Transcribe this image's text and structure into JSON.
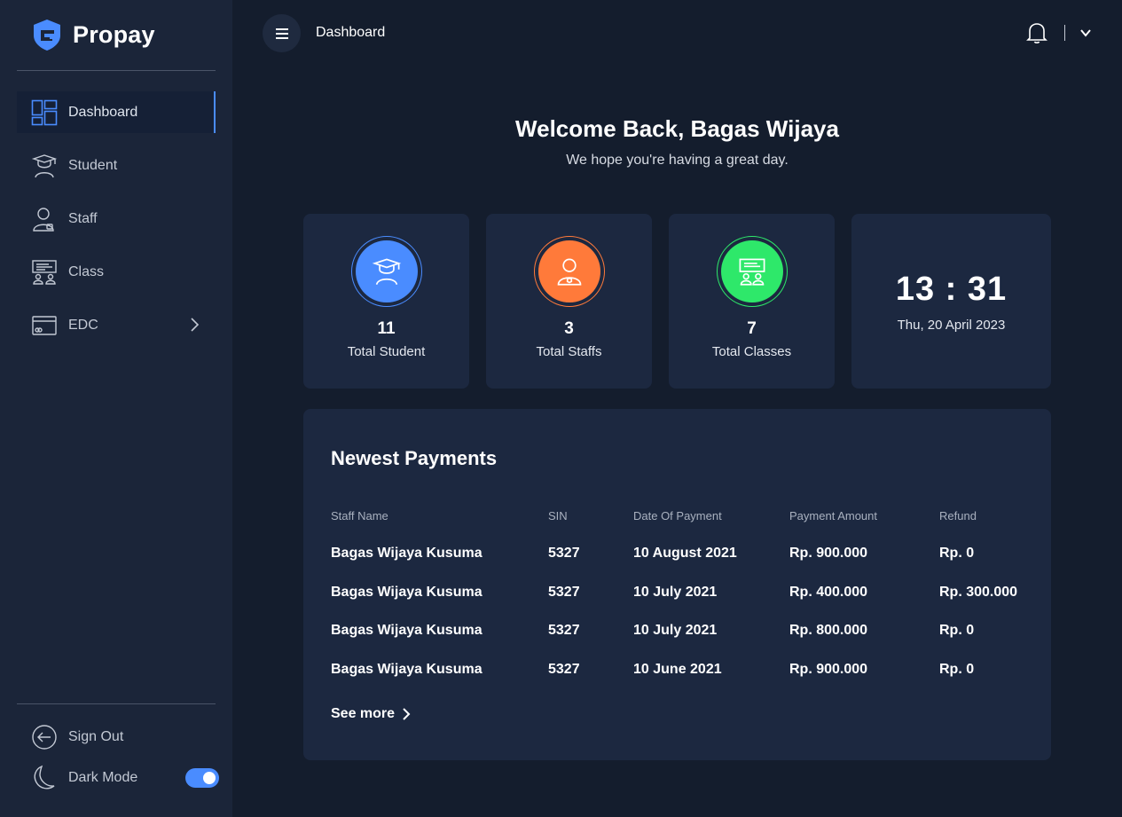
{
  "brand": {
    "name": "Propay",
    "accent": "#4a8cff"
  },
  "sidebar": {
    "items": [
      {
        "label": "Dashboard",
        "icon": "dashboard-icon",
        "active": true
      },
      {
        "label": "Student",
        "icon": "graduation-cap-icon"
      },
      {
        "label": "Staff",
        "icon": "staff-icon"
      },
      {
        "label": "Class",
        "icon": "classroom-icon"
      },
      {
        "label": "EDC",
        "icon": "card-terminal-icon",
        "has_submenu": true
      }
    ],
    "bottom": {
      "sign_out": "Sign Out",
      "dark_mode": "Dark Mode",
      "dark_mode_on": true
    }
  },
  "topbar": {
    "breadcrumb": "Dashboard",
    "icons": [
      "menu-icon",
      "bell-icon",
      "chevron-down-icon"
    ]
  },
  "welcome": {
    "title": "Welcome Back, Bagas Wijaya",
    "subtitle": "We hope you're having a great day."
  },
  "stats": [
    {
      "value": "11",
      "label": "Total Student",
      "color": "#4a8cff",
      "icon": "graduation-cap-icon"
    },
    {
      "value": "3",
      "label": "Total Staffs",
      "color": "#ff7a3a",
      "icon": "staff-icon"
    },
    {
      "value": "7",
      "label": "Total Classes",
      "color": "#2ee86a",
      "icon": "classroom-icon"
    }
  ],
  "clock": {
    "time": "13 : 31",
    "date": "Thu, 20 April 2023"
  },
  "payments": {
    "title": "Newest Payments",
    "columns": [
      "Staff Name",
      "SIN",
      "Date Of Payment",
      "Payment Amount",
      "Refund"
    ],
    "rows": [
      [
        "Bagas Wijaya Kusuma",
        "5327",
        "10 August 2021",
        "Rp. 900.000",
        "Rp. 0"
      ],
      [
        "Bagas Wijaya Kusuma",
        "5327",
        "10 July 2021",
        "Rp. 400.000",
        "Rp. 300.000"
      ],
      [
        "Bagas Wijaya Kusuma",
        "5327",
        "10 July 2021",
        "Rp. 800.000",
        "Rp. 0"
      ],
      [
        "Bagas Wijaya Kusuma",
        "5327",
        "10 June 2021",
        "Rp. 900.000",
        "Rp. 0"
      ]
    ],
    "see_more": "See more"
  }
}
